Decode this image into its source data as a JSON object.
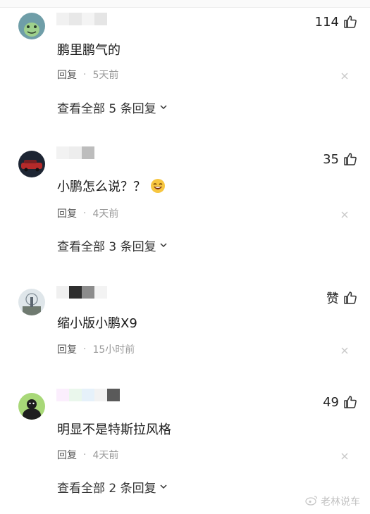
{
  "comments": [
    {
      "likes": "114",
      "text": "鹏里鹏气的",
      "reply_label": "回复",
      "separator": "·",
      "time": "5天前",
      "expand_label": "查看全部 5 条回复"
    },
    {
      "likes": "35",
      "text": "小鹏怎么说？？",
      "emoji_icon": "laughing-emoji-icon",
      "reply_label": "回复",
      "separator": "·",
      "time": "4天前",
      "expand_label": "查看全部 3 条回复"
    },
    {
      "likes": "赞",
      "text": "缩小版小鹏X9",
      "reply_label": "回复",
      "separator": "·",
      "time": "15小时前"
    },
    {
      "likes": "49",
      "text": "明显不是特斯拉风格",
      "reply_label": "回复",
      "separator": "·",
      "time": "4天前",
      "expand_label": "查看全部 2 条回复"
    }
  ],
  "watermark": "老林说车",
  "colors": {
    "text": "#1a1a1a",
    "meta": "#999999",
    "divider": "#ececec"
  }
}
